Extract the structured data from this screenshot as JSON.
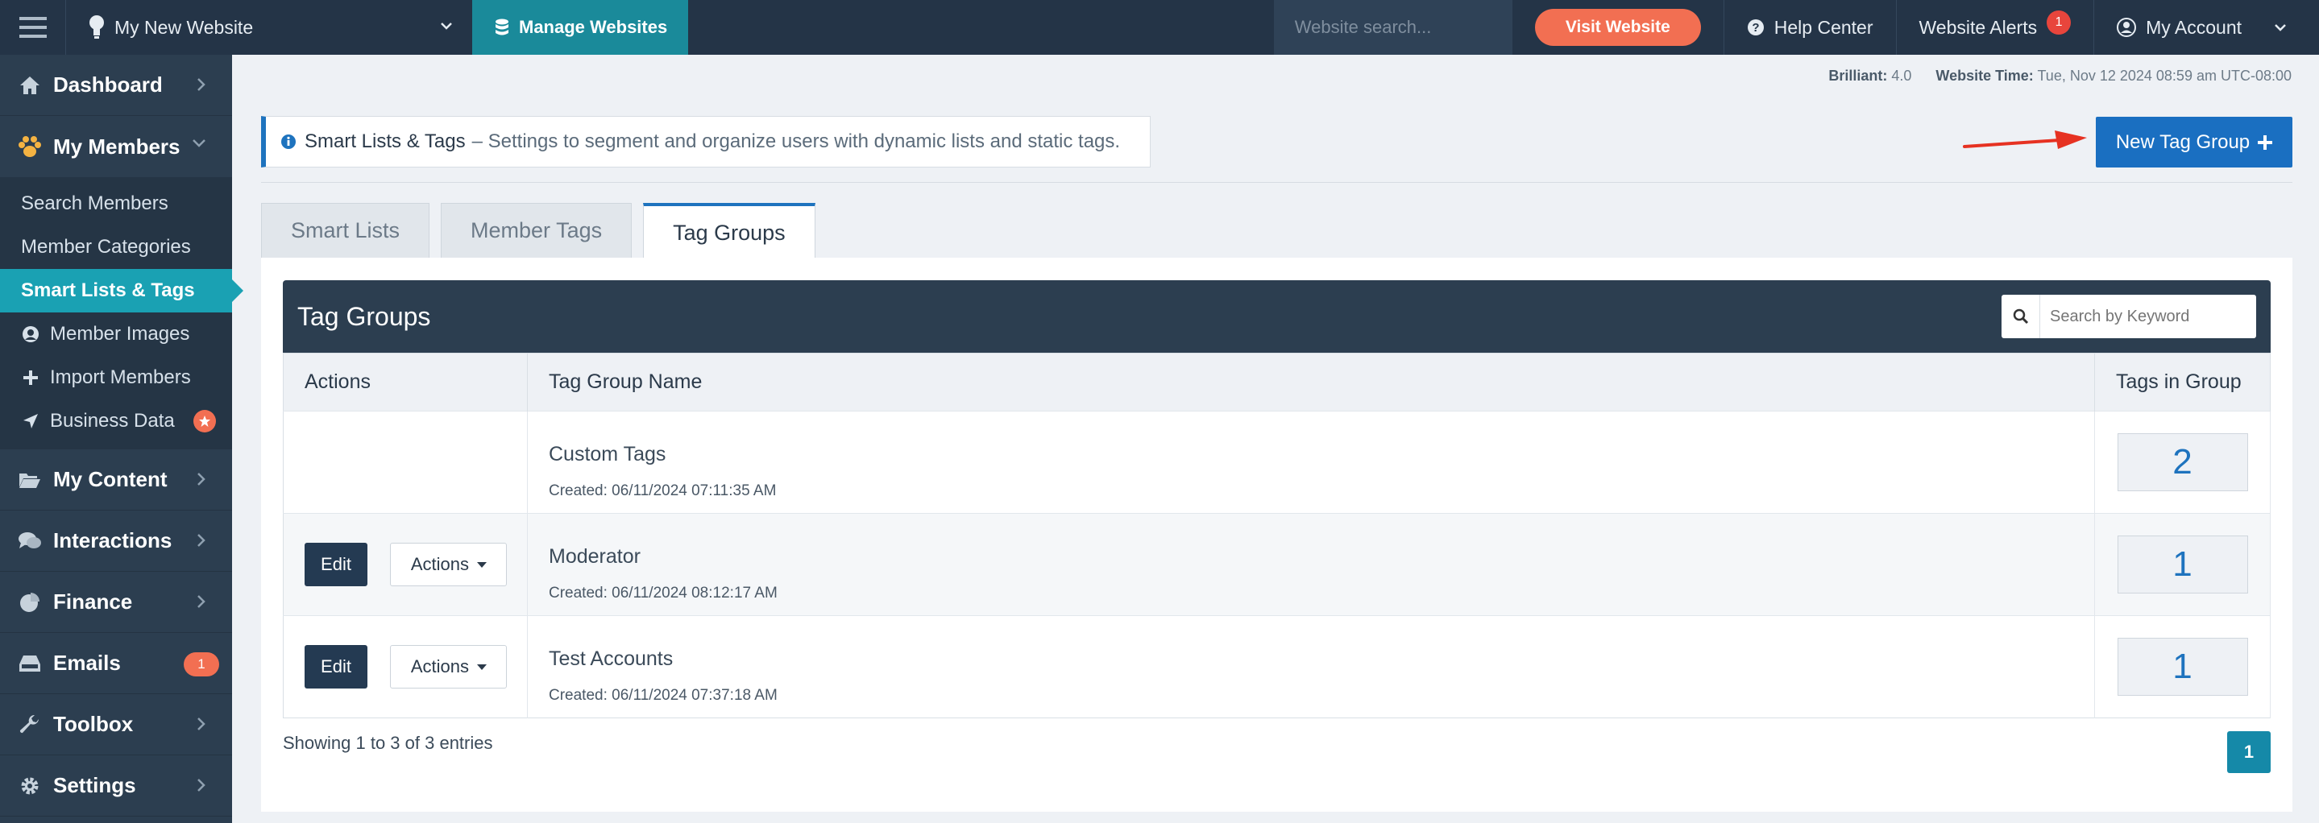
{
  "topbar": {
    "site_name": "My New Website",
    "manage_label": "Manage Websites",
    "search_placeholder": "Website search...",
    "visit_label": "Visit Website",
    "help_label": "Help Center",
    "alerts_label": "Website Alerts",
    "alerts_count": "1",
    "account_label": "My Account"
  },
  "sidebar": {
    "dashboard": "Dashboard",
    "my_members": "My Members",
    "sub_items": [
      {
        "label": "Search Members"
      },
      {
        "label": "Member Categories"
      },
      {
        "label": "Smart Lists & Tags"
      },
      {
        "label": "Member Images"
      },
      {
        "label": "Import Members"
      },
      {
        "label": "Business Data"
      }
    ],
    "my_content": "My Content",
    "interactions": "Interactions",
    "finance": "Finance",
    "emails": "Emails",
    "emails_count": "1",
    "toolbox": "Toolbox",
    "settings": "Settings"
  },
  "meta": {
    "version_label": "Brilliant:",
    "version_value": "4.0",
    "time_label": "Website Time:",
    "time_value": "Tue, Nov 12 2024 08:59 am UTC-08:00"
  },
  "info": {
    "title": "Smart Lists & Tags",
    "description": "– Settings to segment and organize users with dynamic lists and static tags."
  },
  "new_tag_group_label": "New Tag Group",
  "tabs": [
    {
      "label": "Smart Lists"
    },
    {
      "label": "Member Tags"
    },
    {
      "label": "Tag Groups"
    }
  ],
  "panel": {
    "title": "Tag Groups",
    "search_placeholder": "Search by Keyword",
    "columns": [
      "Actions",
      "Tag Group Name",
      "Tags in Group"
    ],
    "rows": [
      {
        "name": "Custom Tags",
        "created": "Created: 06/11/2024 07:11:35 AM",
        "count": "2"
      },
      {
        "name": "Moderator",
        "created": "Created: 06/11/2024 08:12:17 AM",
        "count": "1",
        "edit": "Edit",
        "actions": "Actions"
      },
      {
        "name": "Test Accounts",
        "created": "Created: 06/11/2024 07:37:18 AM",
        "count": "1",
        "edit": "Edit",
        "actions": "Actions"
      }
    ],
    "showing": "Showing 1 to 3 of 3 entries",
    "page": "1"
  },
  "colors": {
    "topbar": "#243447",
    "sidebar": "#2c3e50",
    "teal": "#1a8a9a",
    "accent": "#1a6fc1",
    "orange": "#f26f52"
  }
}
